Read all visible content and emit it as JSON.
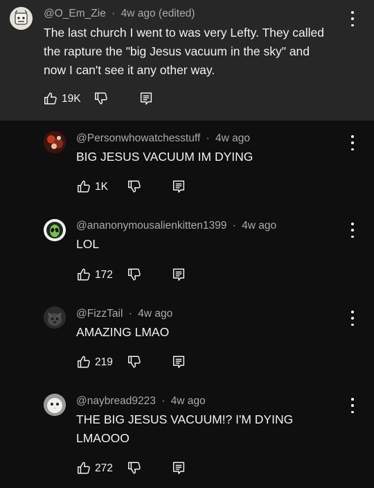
{
  "main_comment": {
    "author": "@O_Em_Zie",
    "time": "4w ago (edited)",
    "lines": [
      "The last church I went to was very Lefty. They called",
      "the rapture the \"big Jesus vacuum in the sky\" and",
      "now I can't see it any other way."
    ],
    "likes": "19K"
  },
  "replies": [
    {
      "author": "@Personwhowatchesstuff",
      "time": "4w ago",
      "lines": [
        "BIG JESUS VACUUM IM DYING"
      ],
      "likes": "1K"
    },
    {
      "author": "@ananonymousalienkitten1399",
      "time": "4w ago",
      "lines": [
        "LOL"
      ],
      "likes": "172"
    },
    {
      "author": "@FizzTail",
      "time": "4w ago",
      "lines": [
        "AMAZING LMAO"
      ],
      "likes": "219"
    },
    {
      "author": "@naybread9223",
      "time": "4w ago",
      "lines": [
        "THE BIG JESUS VACUUM!? I'M DYING",
        "LMAOOO"
      ],
      "likes": "272"
    }
  ],
  "separator": "·",
  "icons": {
    "like": "thumbs-up-icon",
    "dislike": "thumbs-down-icon",
    "reply": "reply-icon",
    "more": "more-vertical-icon"
  },
  "colors": {
    "background": "#0f0f0f",
    "highlight": "#272727",
    "text": "#f1f1f1",
    "meta": "#aaaaaa"
  }
}
